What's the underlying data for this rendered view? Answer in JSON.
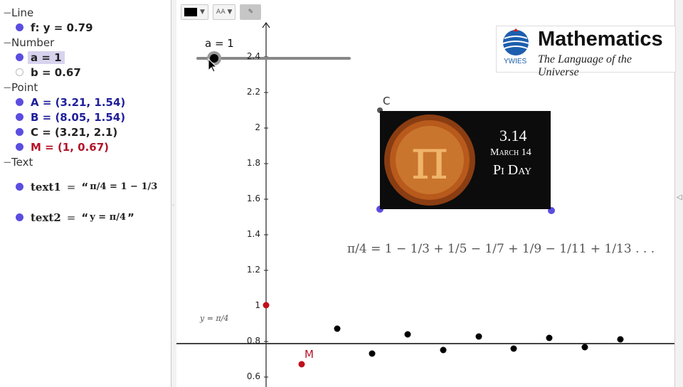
{
  "algebra": {
    "line_header": "Line",
    "line_f": "f: y = 0.79",
    "number_header": "Number",
    "number_a": "a = 1",
    "number_b": "b = 0.67",
    "point_header": "Point",
    "point_A": "A = (3.21, 1.54)",
    "point_B": "B = (8.05, 1.54)",
    "point_C": "C = (3.21, 2.1)",
    "point_M": "M = (1, 0.67)",
    "text_header": "Text",
    "text1_name": "text1",
    "text2_name": "text2",
    "eq": "=",
    "open_quote": "“",
    "close_quote": "”",
    "text1_body_pre": "π/4 = 1 − 1/3",
    "text2_body": "y = π/4"
  },
  "graphics": {
    "slider_label": "a = 1",
    "point_C_label": "C",
    "point_M_label": "M",
    "y_axis_ticks": [
      "2.4",
      "2.2",
      "2",
      "1.8",
      "1.6",
      "1.4",
      "1.2",
      "1",
      "0.8",
      "0.6"
    ],
    "series_text": "π/4 = 1 − 1/3 + 1/5 − 1/7 + 1/9 − 1/11 + 1/13 . . .",
    "line_text": "y = π/4"
  },
  "toolbar": {
    "font_size_label": "AA"
  },
  "logo": {
    "title": "Mathematics",
    "tagline": "The Language of the Universe",
    "org": "YWIES"
  },
  "pi_image": {
    "value": "3.14",
    "date": "March 14",
    "name": "Pi Day",
    "symbol": "π"
  },
  "colors": {
    "blue_point": "#5b4de0",
    "red_point": "#c0101c",
    "selection": "#d7d3ee"
  }
}
